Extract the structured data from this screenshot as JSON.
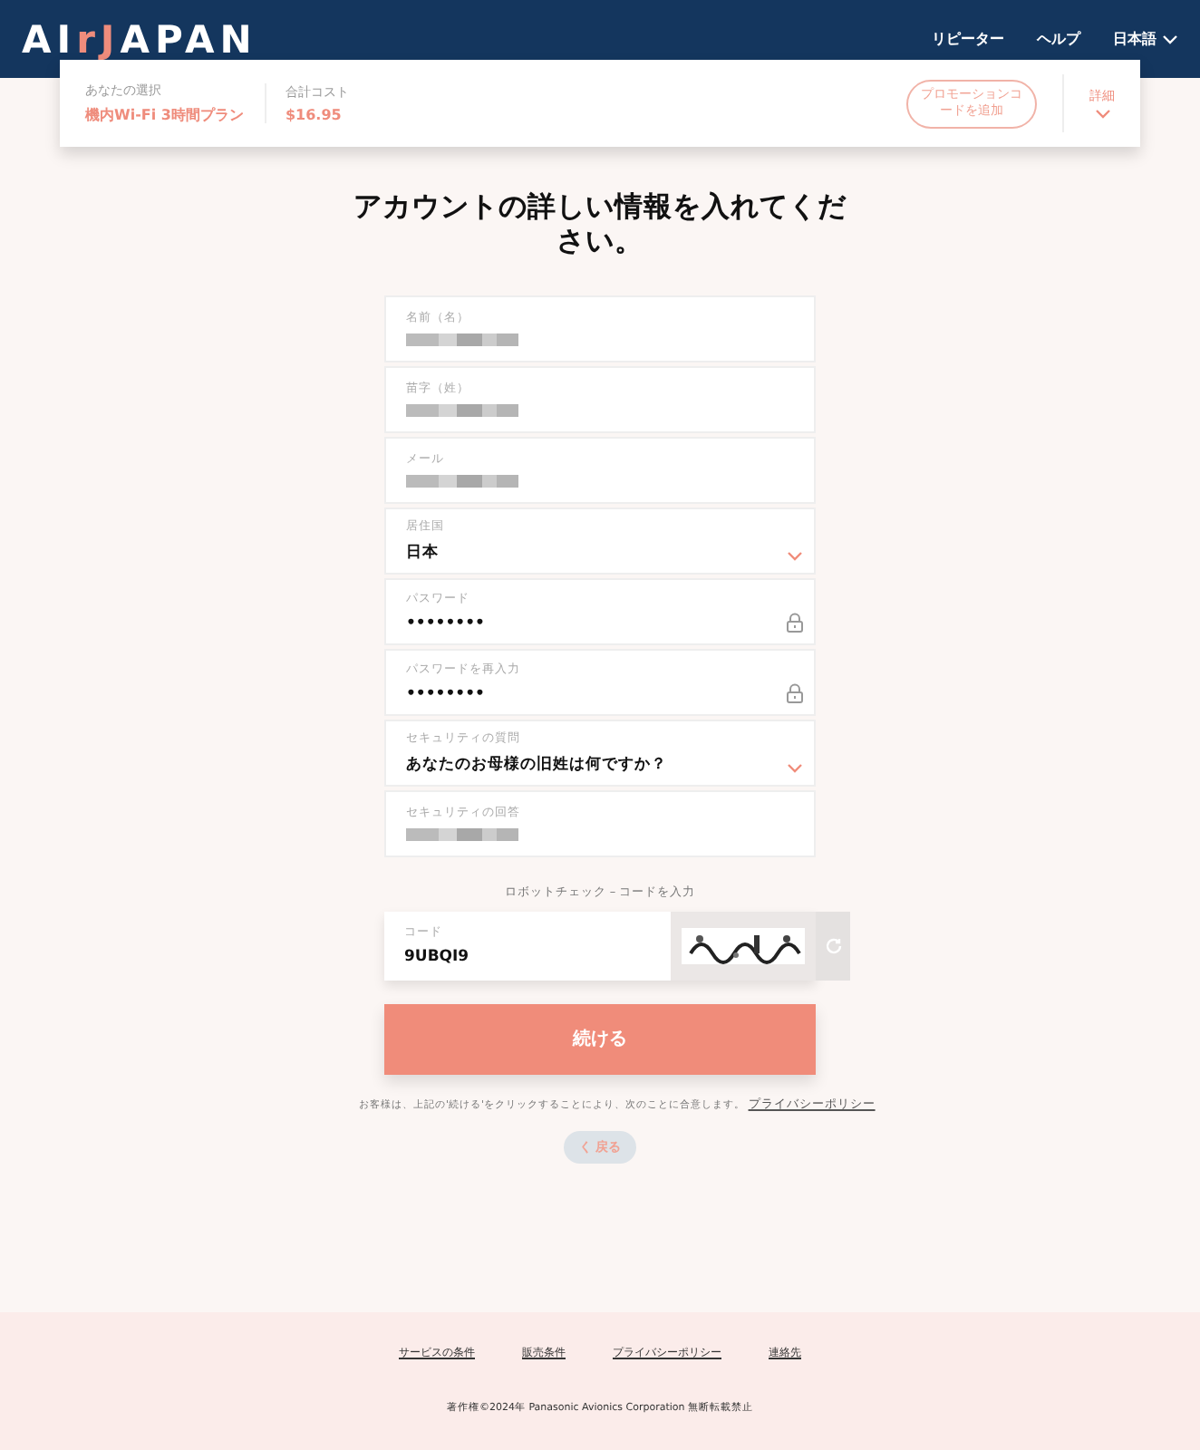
{
  "header": {
    "logo": [
      {
        "text": "AI",
        "accent": false
      },
      {
        "text": "rJ",
        "accent": true
      },
      {
        "text": "APAN",
        "accent": false
      }
    ],
    "nav": [
      {
        "label": "リピーター",
        "kind": "link"
      },
      {
        "label": "ヘルプ",
        "kind": "link"
      },
      {
        "label": "日本語",
        "kind": "dropdown"
      }
    ]
  },
  "summary": {
    "selection_label": "あなたの選択",
    "selection": "機内Wi-Fi 3時間プラン",
    "cost_label": "合計コスト",
    "cost": "$16.95",
    "promo_button": "プロモーションコードを追加",
    "details": "詳細"
  },
  "title": "アカウントの詳しい情報を入れてください。",
  "fields": [
    {
      "label": "名前（名）",
      "kind": "text",
      "redacted": true
    },
    {
      "label": "苗字（姓）",
      "kind": "text",
      "redacted": true
    },
    {
      "label": "メール",
      "kind": "text",
      "redacted": true
    },
    {
      "label": "居住国",
      "kind": "select",
      "value": "日本"
    },
    {
      "label": "パスワード",
      "kind": "password",
      "value": "••••••••"
    },
    {
      "label": "パスワードを再入力",
      "kind": "password",
      "value": "••••••••"
    },
    {
      "label": "セキュリティの質問",
      "kind": "select",
      "value": "あなたのお母様の旧姓は何ですか？"
    },
    {
      "label": "セキュリティの回答",
      "kind": "text",
      "redacted": true
    }
  ],
  "captcha": {
    "heading": "ロボットチェック – コードを入力",
    "label": "コード",
    "value": "9UBQI9"
  },
  "continue_button": "続ける",
  "consent": {
    "text": "お客様は、上記の'続ける'をクリックすることにより、次のことに合意します。",
    "link": "プライバシーポリシー"
  },
  "back_button": "く 戻る",
  "footer": {
    "links": [
      "サービスの条件",
      "販売条件",
      "プライバシーポリシー",
      "連絡先"
    ],
    "copyright": "著作権©2024年 Panasonic Avionics Corporation 無断転載禁止"
  }
}
